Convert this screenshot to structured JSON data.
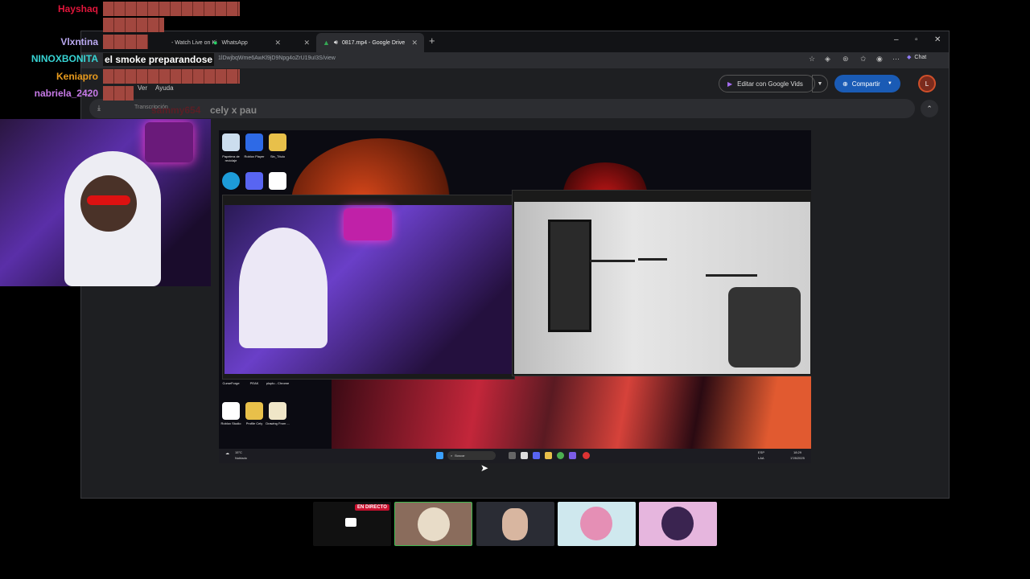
{
  "browser": {
    "tabs": [
      {
        "title": "- Watch Live on Ki",
        "active": false
      },
      {
        "title": "WhatsApp",
        "active": false
      },
      {
        "title": "0817.mp4 - Google Drive",
        "active": true
      }
    ],
    "new_tab": "+",
    "window_controls": {
      "minimize": "–",
      "maximize": "▫",
      "close": "✕"
    },
    "url": "1lDwjbqWme6AwKl9jD9Npg4oZrU19uI3S/view",
    "chat_label": "Chat"
  },
  "drive": {
    "menu": {
      "ver": "Ver",
      "ayuda": "Ayuda"
    },
    "vids_button": "Editar con Google Vids",
    "share_button": "Compartir",
    "avatar_letter": "L",
    "transcription_label": "Transcripción"
  },
  "chat": {
    "messages": [
      {
        "user": "Hayshaq",
        "color": "#e0163b",
        "text": ""
      },
      {
        "user": "Vlxntina",
        "color": "#b9a8f0",
        "text": ""
      },
      {
        "user": "NINOXBONITA",
        "color": "#37d3d3",
        "text": "el smoke preparandose"
      },
      {
        "user": "Keniapro",
        "color": "#e89b1e",
        "text": ""
      },
      {
        "user": "nabriela_2420",
        "color": "#c77ae8",
        "text": ""
      },
      {
        "user": "sammy654",
        "color": "#5a1f26",
        "text": "cely x pau"
      }
    ]
  },
  "video": {
    "desktop_icons": [
      {
        "label": "Papelera de reciclaje"
      },
      {
        "label": "Roblox Player"
      },
      {
        "label": "Sin_Título"
      },
      {
        "label": "CurseForge"
      },
      {
        "label": "PEAK"
      },
      {
        "label": "pluplu - Chrome"
      },
      {
        "label": "Roblox Studio"
      },
      {
        "label": "Profile Cely"
      },
      {
        "label": "Drawing From ..."
      }
    ],
    "taskbar": {
      "weather": "15°C",
      "weather_desc": "Nublado",
      "search": "Buscar",
      "lang": "ESP",
      "lang2": "LAA",
      "time": "18:29",
      "date": "17/8/2025"
    }
  },
  "participants": {
    "live_badge": "EN DIRECTO"
  }
}
